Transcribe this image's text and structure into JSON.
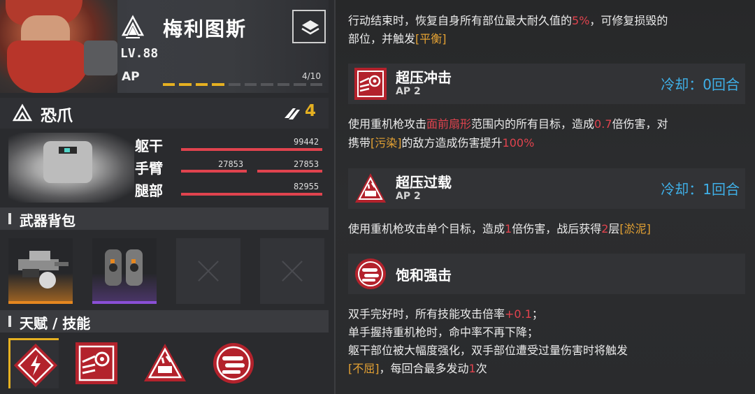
{
  "character": {
    "name": "梅利图斯",
    "level": "LV.88",
    "ap_label": "AP",
    "ap_value": "4/10",
    "ap_current": 4,
    "ap_max": 10
  },
  "mech": {
    "name": "恐爪",
    "count": "4",
    "parts": [
      {
        "label": "躯干",
        "values": [
          "99442"
        ]
      },
      {
        "label": "手臂",
        "values": [
          "27853",
          "27853"
        ]
      },
      {
        "label": "腿部",
        "values": [
          "82955"
        ]
      }
    ]
  },
  "sections": {
    "weapons": "武器背包",
    "talents": "天赋 / 技能"
  },
  "weapons": [
    {
      "rarity": "orange",
      "rarity_color": "#e5871f"
    },
    {
      "rarity": "purple",
      "rarity_color": "#8a4fd6"
    },
    {
      "rarity": "empty"
    },
    {
      "rarity": "empty"
    }
  ],
  "right_panel": {
    "passive_top": {
      "line1_a": "行动结束时，恢复自身所有部位最大耐久值的",
      "line1_b": "5%",
      "line1_c": "，可修复损毁的",
      "line2_a": "部位，并触发",
      "line2_b": "[平衡]"
    },
    "skills": [
      {
        "name": "超压冲击",
        "ap": "AP 2",
        "cooldown": "冷却：0回合",
        "desc": {
          "l1_a": "使用重机枪攻击",
          "l1_b": "面前扇形",
          "l1_c": "范围内的所有目标，造成",
          "l1_d": "0.7",
          "l1_e": "倍伤害，对",
          "l2_a": "携带",
          "l2_b": "[污染]",
          "l2_c": "的敌方造成伤害提升",
          "l2_d": "100%"
        }
      },
      {
        "name": "超压过载",
        "ap": "AP 2",
        "cooldown": "冷却：1回合",
        "desc": {
          "l1_a": "使用重机枪攻击单个目标，造成",
          "l1_b": "1",
          "l1_c": "倍伤害，战后获得",
          "l1_d": "2",
          "l1_e": "层",
          "l1_f": "[淤泥]"
        }
      },
      {
        "name": "饱和强击",
        "desc": {
          "l1_a": "双手完好时，所有技能攻击倍率",
          "l1_b": "+0.1",
          "l1_c": "；",
          "l2": "单手握持重机枪时，命中率不再下降；",
          "l3": "躯干部位被大幅度强化，双手部位遭受过量伤害时将触发",
          "l4_a": "[不屈]",
          "l4_b": "，每回合最多发动",
          "l4_c": "1",
          "l4_d": "次"
        }
      }
    ]
  },
  "colors": {
    "accent_yellow": "#e5b021",
    "hp_red": "#e0434e",
    "cooldown_blue": "#3fb0e8",
    "keyword_orange": "#e5a233"
  }
}
